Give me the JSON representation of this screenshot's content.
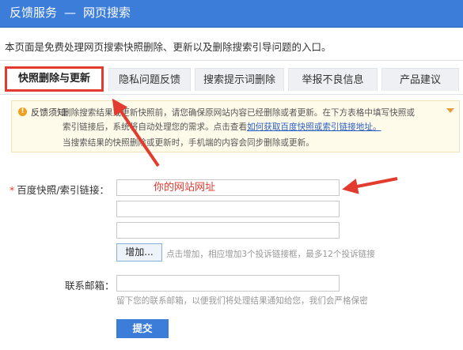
{
  "header": {
    "title_main": "反馈服务",
    "separator": "—",
    "title_sub": "网页搜索"
  },
  "intro": "本页面是免费处理网页搜索快照删除、更新以及删除搜索引导问题的入口。",
  "tabs": [
    {
      "label": "快照删除与更新",
      "active": true
    },
    {
      "label": "隐私问题反馈",
      "active": false
    },
    {
      "label": "搜索提示词删除",
      "active": false
    },
    {
      "label": "举报不良信息",
      "active": false
    },
    {
      "label": "产品建议",
      "active": false
    }
  ],
  "notice": {
    "icon": "warning-icon",
    "label": "反馈须知:",
    "line1": "删除搜索结果或更新快照前，请您确保原网站内容已经删除或者更新。在下方表格中填写快照或",
    "line2_prefix": "索引链接后，系统将自动处理您的需求。点击查看",
    "line2_link": "如何获取百度快照或索引链接地址。",
    "line3": "当搜索结果的快照删除或更新时，手机端的内容会同步删除或更新。"
  },
  "form": {
    "link_label": "百度快照/索引链接：",
    "link_value": "你的网站网址",
    "add_button": "增加...",
    "add_hint": "点击增加，相应增加3个投诉链接框，最多12个投诉链接",
    "email_label": "联系邮箱：",
    "email_hint": "留下您的联系邮箱，以便我们将处理结果通知给您，我们会严格保密",
    "submit": "提交"
  },
  "colors": {
    "header_bg": "#3b7dd8",
    "annotation_red": "#e23b30",
    "link_blue": "#2a5fc4"
  }
}
